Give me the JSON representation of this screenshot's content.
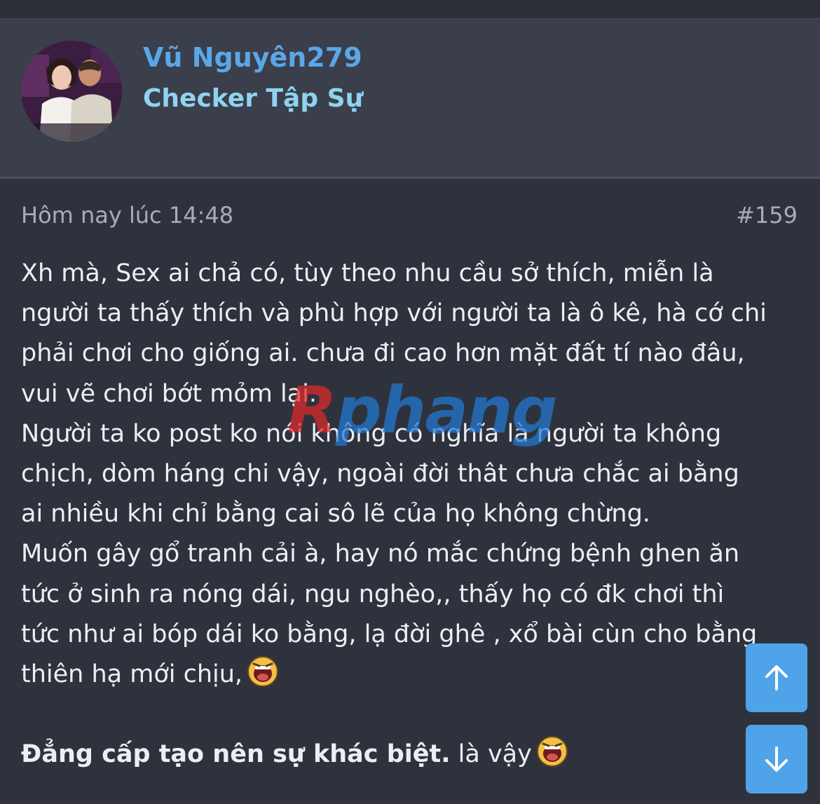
{
  "user": {
    "name": "Vũ Nguyên279",
    "title": "Checker Tập Sự"
  },
  "post": {
    "timestamp": "Hôm nay lúc 14:48",
    "number": "#159",
    "lines": [
      "Xh mà, Sex ai chả có, tùy theo nhu cầu sở thích, miễn là",
      "người ta thấy thích và phù hợp với người ta là ô kê, hà cớ chi",
      "phải chơi cho giống ai. chưa đi cao hơn mặt đất tí nào đâu,",
      "vui vẽ chơi bớt mỏm lại.",
      "Người ta ko post ko nói không có nghĩa là người ta không",
      "chịch, dòm háng chi vậy, ngoài đời thât chưa chắc ai bằng",
      "ai nhiều khi chỉ bằng cai sô lẽ của họ không chừng.",
      "Muốn gây gổ tranh cải à, hay nó mắc chứng bệnh ghen ăn",
      "tức ở sinh ra nóng dái, ngu nghèo,, thấy họ có đk chơi thì",
      "tức như ai bóp dái ko bằng, lạ đời ghê , xổ bài cùn cho bằng",
      "thiên hạ mới chịu,"
    ],
    "signature_bold": "Đẳng cấp tạo nên sự khác biệt.",
    "signature_rest": " là vậy"
  },
  "watermark": {
    "first": "R",
    "rest": "phang"
  },
  "icons": {
    "emoji": "laughing-emoji-icon",
    "scroll_up": "arrow-up-icon",
    "scroll_down": "arrow-down-icon"
  },
  "colors": {
    "background": "#2e323d",
    "header": "#3a3f4b",
    "username": "#5aa7e8",
    "user_title": "#8fd3ef",
    "meta": "#a8acb5",
    "text": "#eceef2",
    "button": "#4fa3e8"
  }
}
